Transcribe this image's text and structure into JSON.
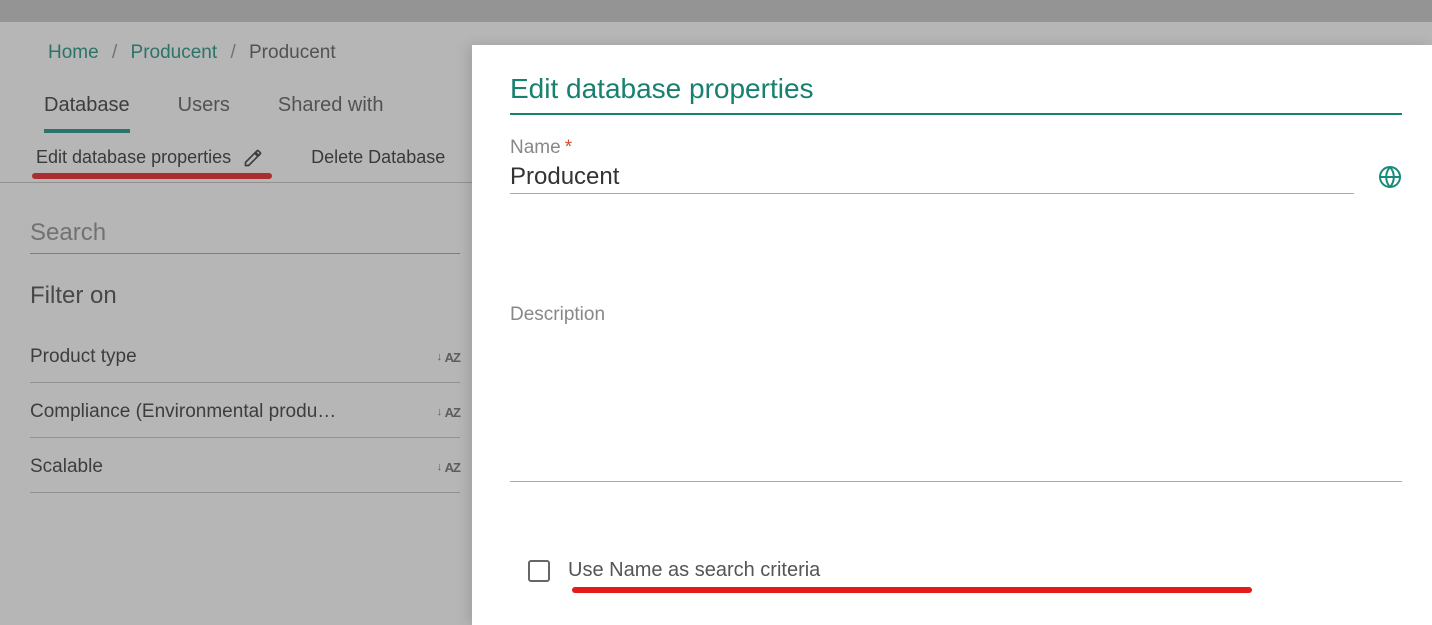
{
  "breadcrumb": {
    "home": "Home",
    "parent": "Producent",
    "current": "Producent"
  },
  "tabs": {
    "database": "Database",
    "users": "Users",
    "shared": "Shared with"
  },
  "actions": {
    "edit": "Edit database properties",
    "delete": "Delete Database"
  },
  "search": {
    "placeholder": "Search"
  },
  "filters": {
    "title": "Filter on",
    "items": [
      "Product type",
      "Compliance (Environmental produ…",
      "Scalable"
    ]
  },
  "modal": {
    "title": "Edit database properties",
    "name_label": "Name",
    "name_value": "Producent",
    "description_label": "Description",
    "description_value": "",
    "checkbox_label": "Use Name as search criteria"
  }
}
